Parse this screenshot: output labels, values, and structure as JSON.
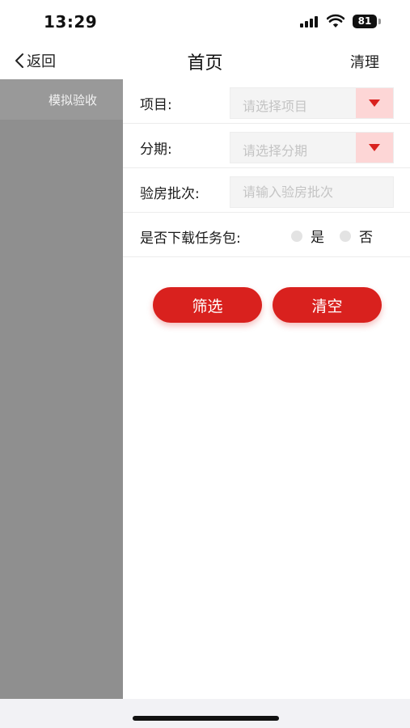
{
  "status_bar": {
    "time": "13:29",
    "battery": "81"
  },
  "nav": {
    "back_label": "返回",
    "title": "首页",
    "action_label": "清理"
  },
  "sidebar": {
    "items": [
      {
        "label": "模拟验收"
      }
    ]
  },
  "filters": {
    "project": {
      "label": "项目:",
      "placeholder": "请选择项目"
    },
    "phase": {
      "label": "分期:",
      "placeholder": "请选择分期"
    },
    "batch": {
      "label": "验房批次:",
      "placeholder": "请输入验房批次",
      "value": ""
    },
    "download": {
      "label": "是否下载任务包:",
      "options": [
        {
          "label": "是"
        },
        {
          "label": "否"
        }
      ]
    }
  },
  "buttons": {
    "filter_label": "筛选",
    "clear_label": "清空"
  },
  "colors": {
    "accent": "#d9211e",
    "arrow_bg": "#fdd6d6",
    "sidebar_bg": "#8f8f8f"
  }
}
